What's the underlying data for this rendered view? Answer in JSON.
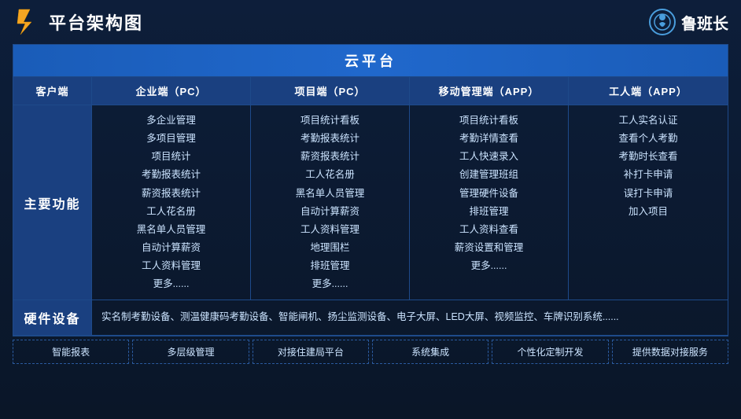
{
  "header": {
    "title": "平台架构图",
    "brand": "鲁班长"
  },
  "cloud": {
    "label": "云平台"
  },
  "columns": {
    "client": "客户端",
    "enterprise": "企业端（PC）",
    "project": "项目端（PC）",
    "mobile": "移动管理端（APP）",
    "worker": "工人端（APP）"
  },
  "main_row": {
    "label": "主要功能",
    "enterprise_items": [
      "多企业管理",
      "多项目管理",
      "项目统计",
      "考勤报表统计",
      "薪资报表统计",
      "工人花名册",
      "黑名单人员管理",
      "自动计算薪资",
      "工人资料管理",
      "更多......"
    ],
    "project_items": [
      "项目统计看板",
      "考勤报表统计",
      "薪资报表统计",
      "工人花名册",
      "黑名单人员管理",
      "自动计算薪资",
      "工人资料管理",
      "地理围栏",
      "排班管理",
      "更多......"
    ],
    "mobile_items": [
      "项目统计看板",
      "考勤详情查看",
      "工人快速录入",
      "创建管理班组",
      "管理硬件设备",
      "排班管理",
      "工人资料查看",
      "薪资设置和管理",
      "更多......"
    ],
    "worker_items": [
      "工人实名认证",
      "查看个人考勤",
      "考勤时长查看",
      "补打卡申请",
      "误打卡申请",
      "加入项目"
    ]
  },
  "hardware": {
    "label": "硬件设备",
    "content": "实名制考勤设备、测温健康码考勤设备、智能闸机、扬尘监测设备、电子大屏、LED大屏、视频监控、车牌识别系统......"
  },
  "features": [
    "智能报表",
    "多层级管理",
    "对接住建局平台",
    "系统集成",
    "个性化定制开发",
    "提供数据对接服务"
  ]
}
